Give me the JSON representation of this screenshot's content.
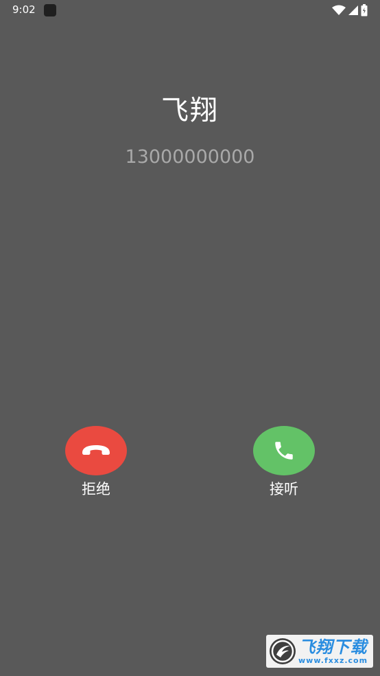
{
  "status_bar": {
    "time": "9:02",
    "icons": [
      "app-notification-icon",
      "wifi-icon",
      "signal-icon",
      "battery-icon"
    ]
  },
  "caller": {
    "name": "飞翔",
    "number": "13000000000"
  },
  "actions": {
    "decline_label": "拒绝",
    "accept_label": "接听",
    "decline_color": "#ea4a40",
    "accept_color": "#63c267"
  },
  "watermark": {
    "title": "飞翔下载",
    "url": "www.fxxz.com",
    "color": "#2a8de0"
  },
  "colors": {
    "background": "#595959",
    "number_text": "#a9a9a9"
  }
}
